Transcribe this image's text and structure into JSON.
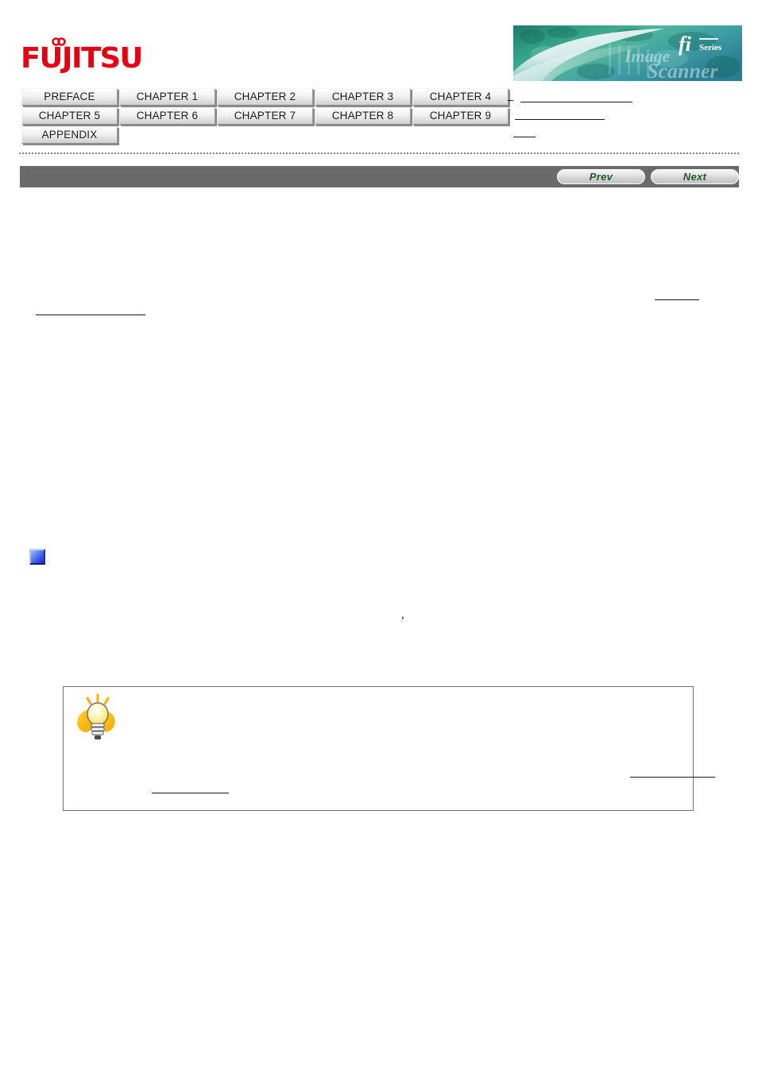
{
  "page": {
    "title": "Fujitsu fi Series Operator's Guide",
    "note": "Body text did not render in this capture; only link underlines, icons and images are visible."
  },
  "header": {
    "logo": {
      "name": "fujitsu-logo",
      "wordmark": "FUJITSU",
      "color": "#e60012",
      "mark": "infinity-mark"
    },
    "banner": {
      "name": "fi-series-banner",
      "brand": "fi",
      "series": "Series",
      "watermark": "Image Scanner",
      "colors": {
        "teal": "#0f6a5c",
        "green": "#2e9e7e",
        "pale": "#d8f0ef",
        "white": "#ffffff"
      }
    }
  },
  "chapter_nav": {
    "name": "chapter-navigation",
    "rows": [
      [
        "PREFACE",
        "CHAPTER 1",
        "CHAPTER 2",
        "CHAPTER 3",
        "CHAPTER 4"
      ],
      [
        "CHAPTER 5",
        "CHAPTER 6",
        "CHAPTER 7",
        "CHAPTER 8",
        "CHAPTER 9"
      ],
      [
        "APPENDIX"
      ]
    ],
    "side_links": [
      "",
      "",
      ""
    ]
  },
  "pager": {
    "prev_label": "Prev",
    "next_label": "Next",
    "bar_color": "#6a6a6a",
    "label_color": "#1e5c2a"
  },
  "content": {
    "breadcrumb_link": "",
    "heading_link": "",
    "section_bullet": "blue-square-bullet",
    "stray_glyph": ",",
    "hint": {
      "icon": "lightbulb-hint-icon",
      "body": "",
      "link_right": "",
      "link_left": ""
    }
  }
}
